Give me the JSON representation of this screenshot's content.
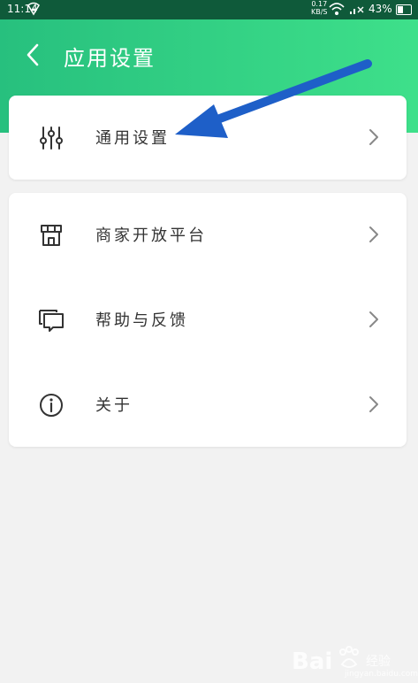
{
  "status": {
    "time": "11:14",
    "speed_top": "0.17",
    "speed_bottom": "KB/S",
    "battery": "43%"
  },
  "header": {
    "title": "应用设置"
  },
  "cards": [
    {
      "items": [
        {
          "label": "通用设置",
          "icon": "sliders-icon"
        }
      ]
    },
    {
      "items": [
        {
          "label": "商家开放平台",
          "icon": "storefront-icon"
        },
        {
          "label": "帮助与反馈",
          "icon": "chat-bubbles-icon"
        },
        {
          "label": "关于",
          "icon": "info-icon"
        }
      ]
    }
  ],
  "colors": {
    "header_start": "#27c07e",
    "header_end": "#3ee08a",
    "arrow": "#1e5fc8",
    "background": "#f2f2f2"
  },
  "watermark": {
    "brand": "Bai",
    "brand_suffix": "经验",
    "url": "jingyan.baidu.com"
  }
}
